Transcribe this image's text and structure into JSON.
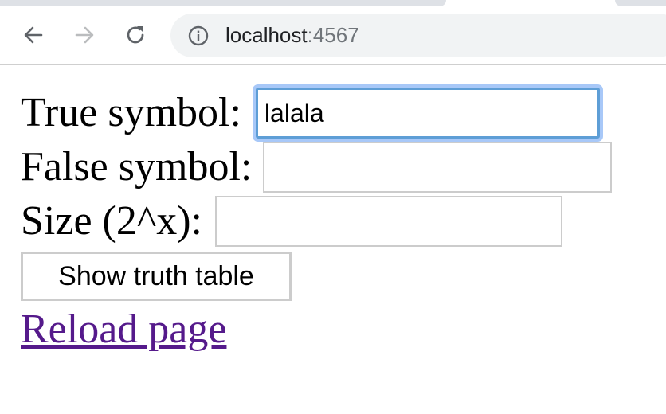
{
  "browser": {
    "url_host": "localhost",
    "url_port": ":4567",
    "back_icon": "arrow-left-icon",
    "forward_icon": "arrow-right-icon",
    "reload_icon": "reload-icon",
    "info_icon": "info-circle-icon",
    "colors": {
      "toolbar_icon": "#5f6368",
      "toolbar_icon_disabled": "#babcbe",
      "omnibox_bg": "#f1f3f4"
    }
  },
  "form": {
    "true_label": "True symbol:",
    "true_value": "lalala",
    "false_label": "False symbol:",
    "false_value": "",
    "size_label": "Size (2^x):",
    "size_value": "",
    "submit_label": "Show truth table"
  },
  "links": {
    "reload_label": "Reload page",
    "color": "#551a8b"
  },
  "colors": {
    "focus_ring": "#a8c8f8",
    "focus_border": "#5e9ed6",
    "input_border": "#cccccc"
  }
}
